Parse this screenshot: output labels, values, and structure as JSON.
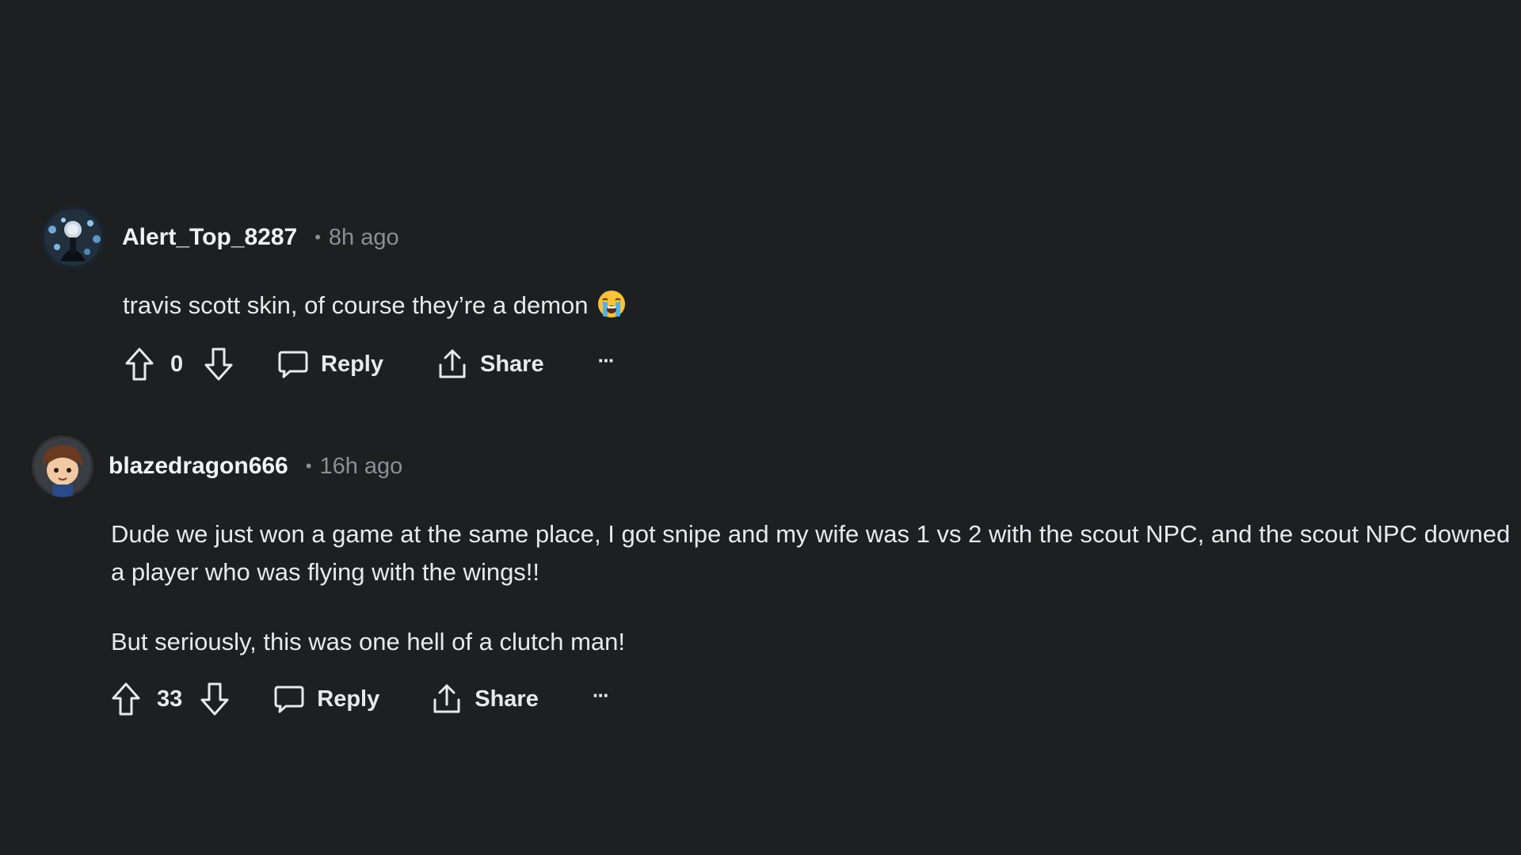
{
  "comments": [
    {
      "username": "Alert_Top_8287",
      "separator": "•",
      "time": "8h ago",
      "paragraphs": [
        "travis scott skin, of course they’re a demon"
      ],
      "emoji": "loudly-crying-face",
      "score": "0",
      "reply_label": "Reply",
      "share_label": "Share",
      "more_label": "···"
    },
    {
      "username": "blazedragon666",
      "separator": "•",
      "time": "16h ago",
      "paragraphs": [
        "Dude we just won a game at the same place, I got snipe and my wife was 1 vs 2 with the scout NPC, and the scout NPC downed a player who was flying with the wings!!",
        "But seriously, this was one hell of a clutch man!"
      ],
      "score": "33",
      "reply_label": "Reply",
      "share_label": "Share",
      "more_label": "···"
    }
  ],
  "icons": {
    "upvote": "arrow-up-outline-icon",
    "downvote": "arrow-down-outline-icon",
    "reply": "speech-bubble-icon",
    "share": "share-upload-icon",
    "more": "ellipsis-icon"
  },
  "colors": {
    "background": "#1e1f21",
    "text": "#f2f3f5",
    "meta": "#8b8f95"
  }
}
